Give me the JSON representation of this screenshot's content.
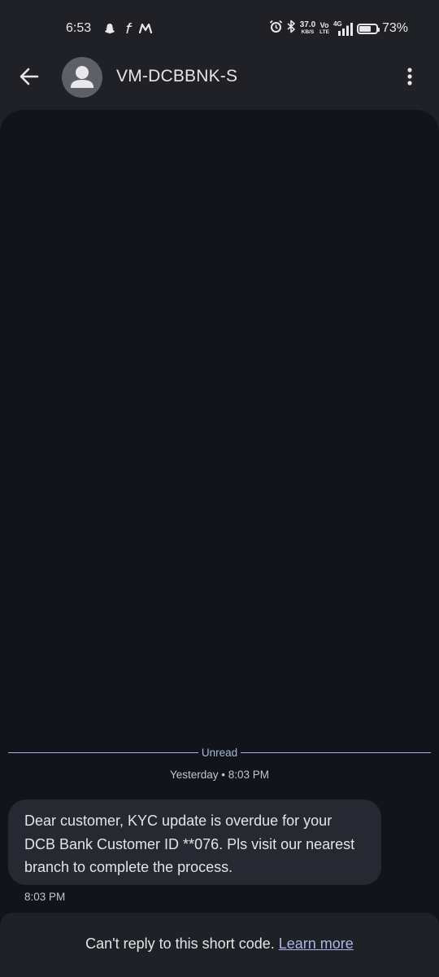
{
  "status_bar": {
    "time": "6:53",
    "net_speed_value": "37.0",
    "net_speed_unit": "KB/S",
    "volte_top": "Vo",
    "volte_bottom": "LTE",
    "network": "4G",
    "battery_percent": "73%",
    "battery_level": 0.73,
    "notification_icons": [
      "snapchat-icon",
      "flipkart-icon",
      "myntra-icon"
    ]
  },
  "app_bar": {
    "title": "VM-DCBBNK-S"
  },
  "conversation": {
    "unread_label": "Unread",
    "date_label": "Yesterday • 8:03 PM",
    "message_text": "Dear customer, KYC update is overdue for your DCB Bank Customer ID **076. Pls visit our nearest branch to complete the process.",
    "message_time": "8:03 PM"
  },
  "footer": {
    "notice": "Can't reply to this short code.",
    "link": "Learn more"
  },
  "colors": {
    "background": "#1f2126",
    "conversation_bg": "#11141a",
    "bubble": "#262931",
    "accent": "#a9b8ec"
  }
}
